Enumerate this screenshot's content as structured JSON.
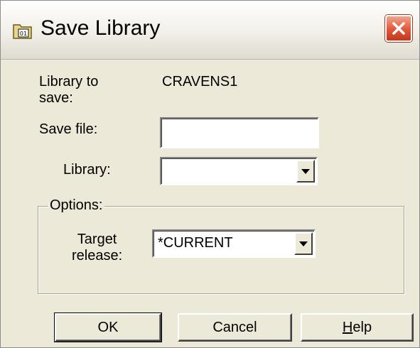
{
  "window": {
    "title": "Save Library",
    "icon": "library-folder-icon"
  },
  "form": {
    "library_to_save_label_line1": "Library to",
    "library_to_save_label_line2": "save:",
    "library_to_save_value": "CRAVENS1",
    "save_file_label": "Save file:",
    "save_file_value": "",
    "library_label": "Library:",
    "library_value": ""
  },
  "options": {
    "legend": "Options:",
    "target_release_label_line1": "Target",
    "target_release_label_line2": "release:",
    "target_release_value": "*CURRENT"
  },
  "buttons": {
    "ok": "OK",
    "cancel": "Cancel",
    "help_mnemonic": "H",
    "help_rest": "elp"
  },
  "colors": {
    "dialog_background": "#ece9d8",
    "close_button": "#e0573a"
  }
}
